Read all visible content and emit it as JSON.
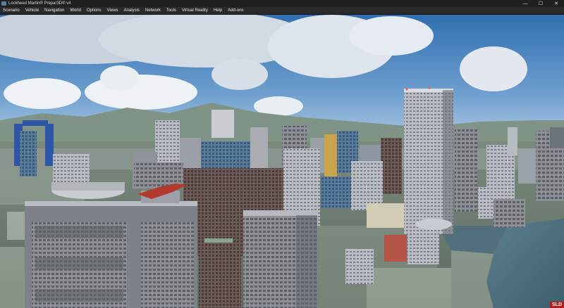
{
  "window": {
    "title": "Lockheed Martin® Prepar3D® v4",
    "minimize_glyph": "—",
    "maximize_glyph": "☐",
    "close_glyph": "✕"
  },
  "menu": {
    "items": [
      {
        "label": "Scenario"
      },
      {
        "label": "Vehicle"
      },
      {
        "label": "Navigation"
      },
      {
        "label": "World"
      },
      {
        "label": "Options"
      },
      {
        "label": "Views"
      },
      {
        "label": "Analysis"
      },
      {
        "label": "Network"
      },
      {
        "label": "Tools"
      },
      {
        "label": "Virtual Reality"
      },
      {
        "label": "Help"
      },
      {
        "label": "Add-ons"
      }
    ]
  },
  "overlay": {
    "badge_text": "SLD"
  },
  "colors": {
    "titlebar": "#202020",
    "menubar": "#2a2a2a",
    "sky_top": "#2f6fb0",
    "sky_bottom": "#a9c8e0",
    "badge": "#b31b1b"
  }
}
